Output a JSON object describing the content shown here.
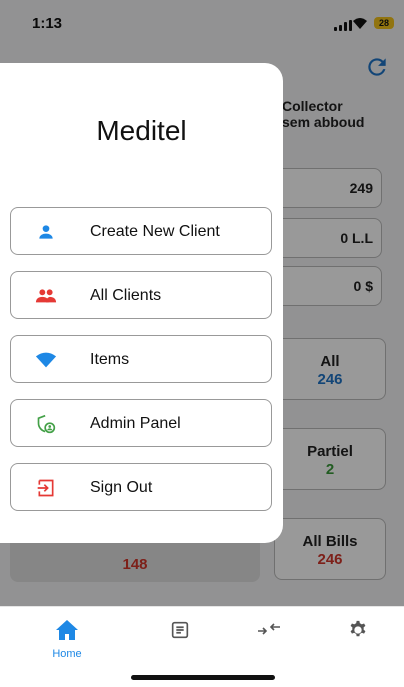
{
  "status_bar": {
    "time": "1:13",
    "battery": "28"
  },
  "background": {
    "collector_lines": [
      "Collector",
      "sem abboud"
    ],
    "fields": [
      "249",
      "0 L.L",
      "0 $"
    ],
    "cards": [
      {
        "label": "All",
        "value": "246",
        "color": "#1e73c7"
      },
      {
        "label": "Partiel",
        "value": "2",
        "color": "#3a9a3a"
      },
      {
        "label": "All Bills",
        "value": "246",
        "color": "#d0362b"
      }
    ],
    "left_card_value": "148"
  },
  "drawer": {
    "title": "Meditel",
    "items": [
      {
        "label": "Create New Client",
        "icon": "person-icon"
      },
      {
        "label": "All Clients",
        "icon": "people-icon"
      },
      {
        "label": "Items",
        "icon": "wifi-icon"
      },
      {
        "label": "Admin Panel",
        "icon": "admin-shield-icon"
      },
      {
        "label": "Sign Out",
        "icon": "sign-out-icon"
      }
    ]
  },
  "tabs": [
    {
      "label": "Home",
      "icon": "home-icon",
      "active": true
    },
    {
      "label": "",
      "icon": "document-icon"
    },
    {
      "label": "",
      "icon": "transfer-icon"
    },
    {
      "label": "",
      "icon": "settings-icon"
    }
  ],
  "colors": {
    "accent": "#1e88e5",
    "danger": "#e53935",
    "success": "#43a047"
  }
}
